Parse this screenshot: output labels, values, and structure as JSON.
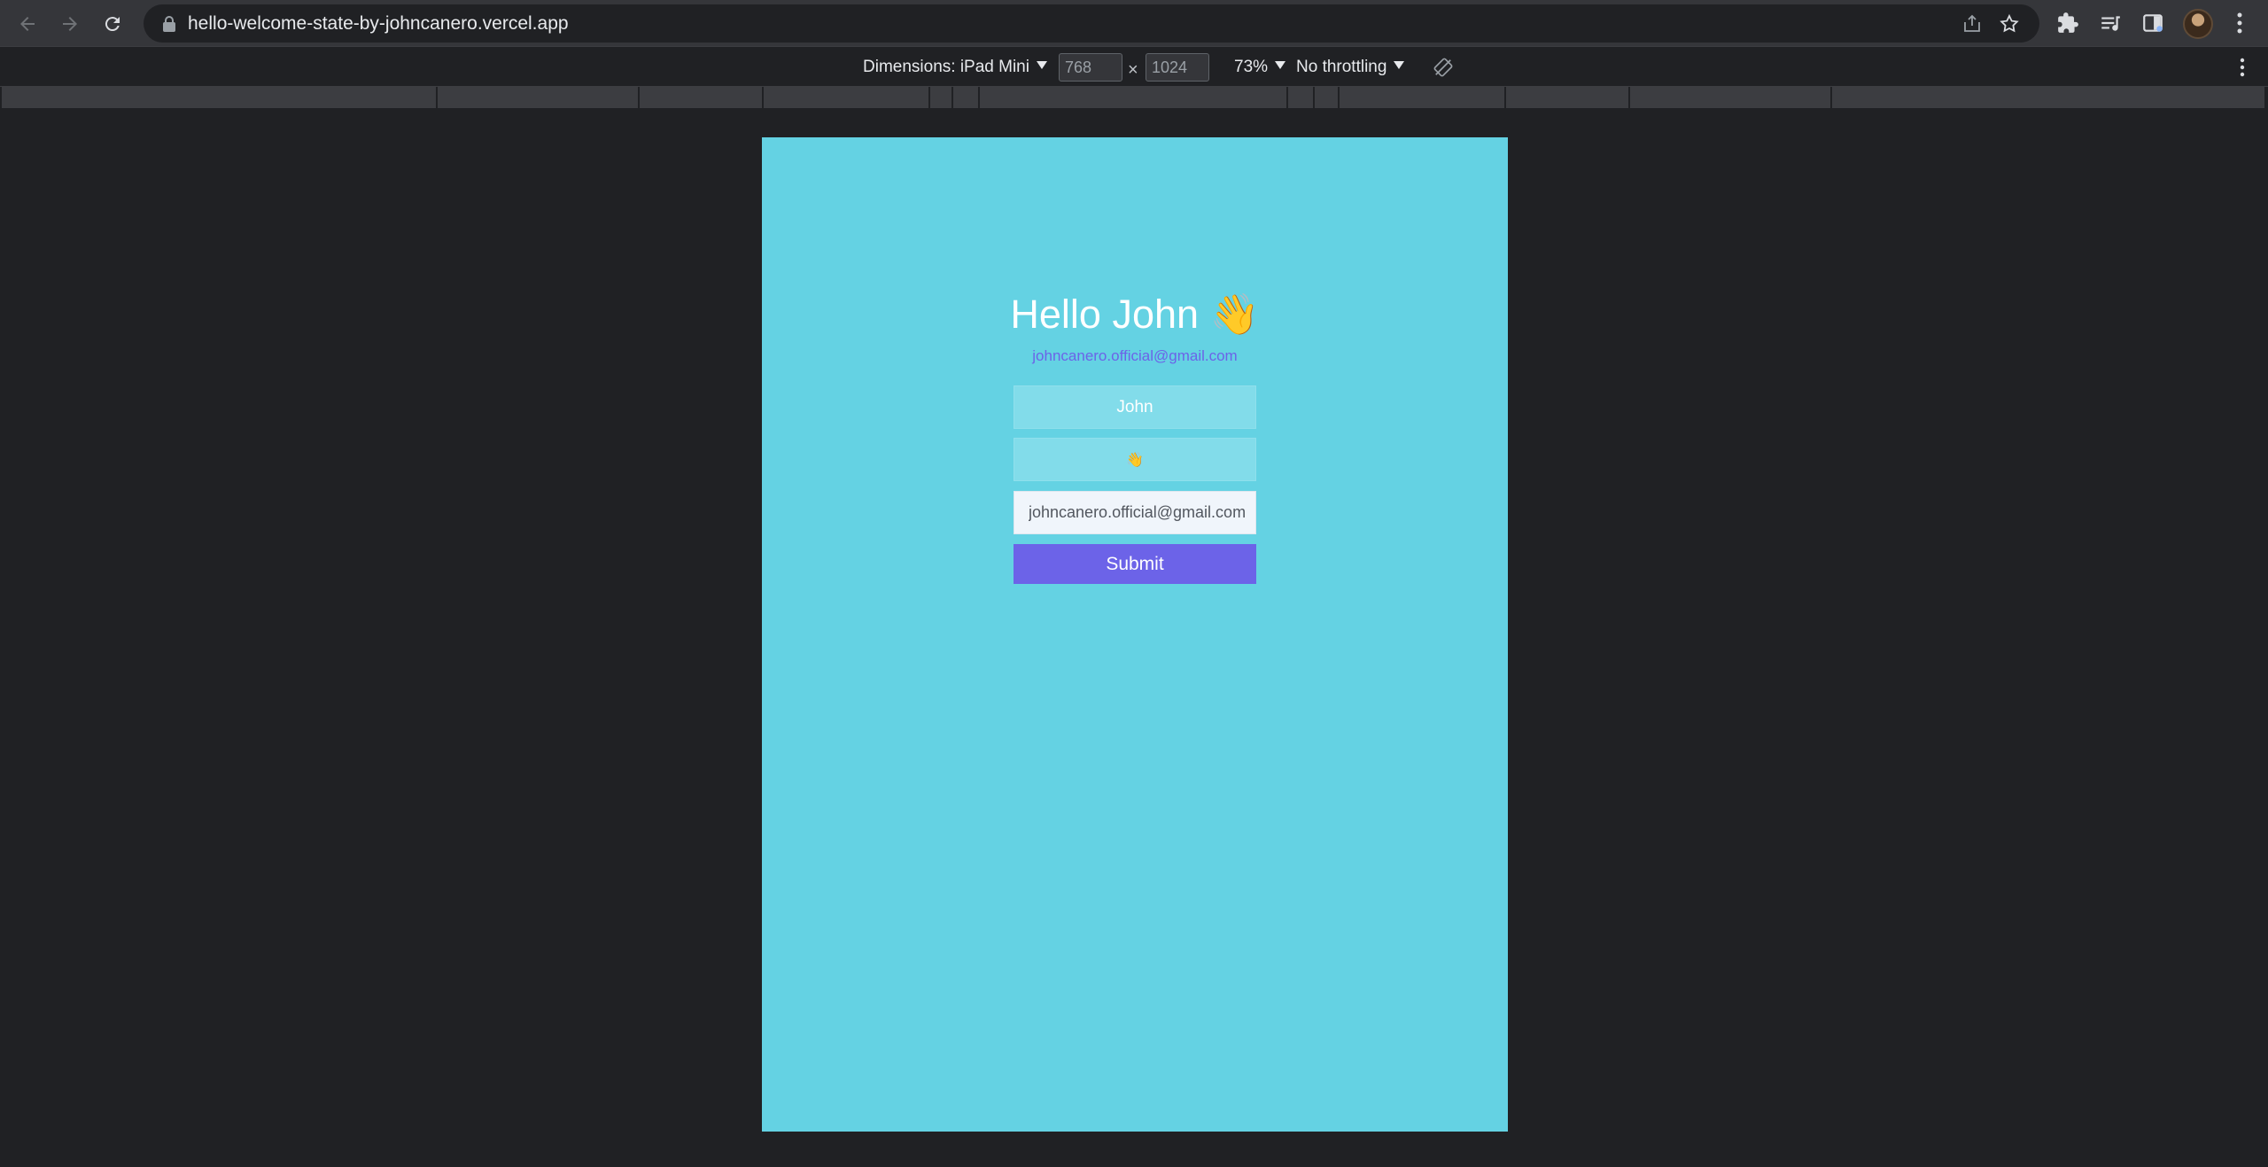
{
  "browser": {
    "url": "hello-welcome-state-by-johncanero.vercel.app",
    "icons": {
      "back": "arrow-left-icon",
      "forward": "arrow-right-icon",
      "reload": "reload-icon",
      "secure": "lock-icon",
      "share": "share-icon",
      "bookmark": "star-icon",
      "extensions": "puzzle-icon",
      "media": "media-queue-icon",
      "sidepanel": "side-panel-icon",
      "menu": "kebab-menu-icon"
    }
  },
  "device_toolbar": {
    "dimensions_label": "Dimensions: iPad Mini",
    "width": "768",
    "height": "1024",
    "times": "×",
    "zoom": "73%",
    "throttling": "No throttling",
    "rotate_icon": "rotate-icon"
  },
  "page": {
    "background_color": "#64d2e3",
    "greeting_prefix": "Hello John",
    "greeting_emoji": "👋",
    "email_display": "johncanero.official@gmail.com",
    "name_field_value": "John",
    "emoji_field_value": "👋",
    "email_field_value": "johncanero.official@gmail.com",
    "submit_label": "Submit",
    "accent_color": "#6c63e8"
  }
}
